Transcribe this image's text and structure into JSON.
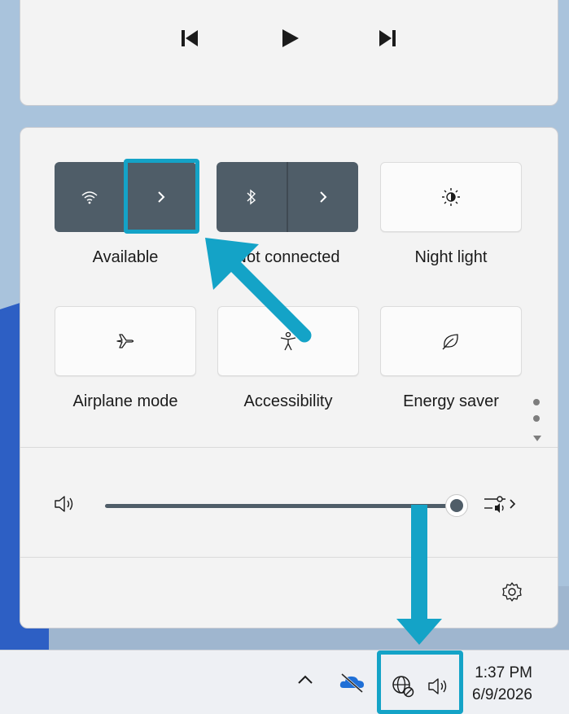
{
  "media_controls": {
    "previous_icon": "previous-track-icon",
    "play_icon": "play-icon",
    "next_icon": "next-track-icon"
  },
  "quick_settings": {
    "tiles": [
      {
        "id": "wifi",
        "label": "Available",
        "icon": "wifi-icon",
        "style": "split",
        "state": "on"
      },
      {
        "id": "bluetooth",
        "label": "Not connected",
        "icon": "bluetooth-icon",
        "style": "split",
        "state": "on"
      },
      {
        "id": "night-light",
        "label": "Night light",
        "icon": "brightness-icon",
        "style": "plain",
        "state": "off"
      },
      {
        "id": "airplane",
        "label": "Airplane mode",
        "icon": "airplane-icon",
        "style": "plain",
        "state": "off"
      },
      {
        "id": "accessibility",
        "label": "Accessibility",
        "icon": "accessibility-icon",
        "style": "plain",
        "state": "off"
      },
      {
        "id": "energy-saver",
        "label": "Energy saver",
        "icon": "leaf-icon",
        "style": "plain",
        "state": "off"
      }
    ],
    "volume_level": 0.95
  },
  "taskbar": {
    "time": "1:37 PM",
    "date": "6/9/2026",
    "icons": [
      "chevron-up-icon",
      "onedrive-offline-icon",
      "network-globe-icon",
      "speaker-icon"
    ]
  },
  "colors": {
    "accent_highlight": "#14a3c7",
    "tile_active": "#4f5d68",
    "panel_bg": "#f3f3f3"
  }
}
